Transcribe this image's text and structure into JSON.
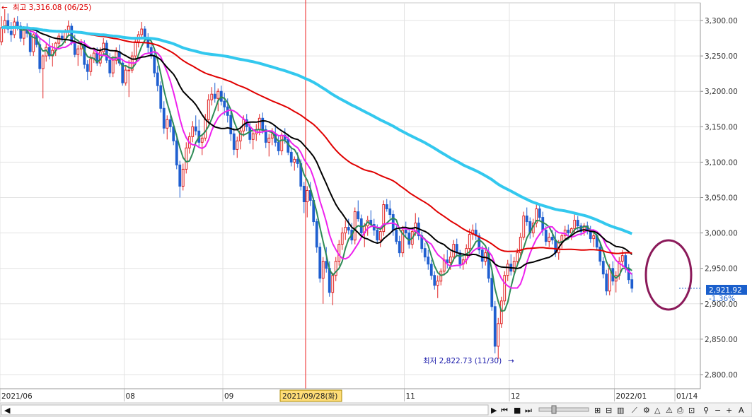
{
  "chart_data": {
    "type": "candlestick",
    "y_ticks": [
      "3,300.00",
      "3,250.00",
      "3,200.00",
      "3,150.00",
      "3,100.00",
      "3,050.00",
      "3,000.00",
      "2,950.00",
      "2,900.00",
      "2,850.00",
      "2,800.00"
    ],
    "y_range": [
      2780,
      3325
    ],
    "x_labels": [
      {
        "label": "2021/06",
        "index": 0
      },
      {
        "label": "08",
        "index": 39
      },
      {
        "label": "09",
        "index": 70
      },
      {
        "label": "11",
        "index": 127
      },
      {
        "label": "12",
        "index": 160
      },
      {
        "label": "2022/01",
        "index": 193
      },
      {
        "label": "01/14",
        "index": 212
      }
    ],
    "cursor": {
      "label": "2021/09/28(화)",
      "index": 96
    },
    "annotations": {
      "high": {
        "text": "최고 3,316.08 (06/25)",
        "value": 3316.08,
        "index": 0
      },
      "low": {
        "text": "최저 2,822.73 (11/30)",
        "value": 2822.73,
        "index": 160
      }
    },
    "last_price": {
      "value_text": "2,921.92",
      "change_text": "-1.36%",
      "value": 2921.92
    },
    "series": [
      {
        "color": "#2e8b57"
      },
      {
        "color": "#ee22ee"
      },
      {
        "color": "#000000"
      },
      {
        "color": "#e00000"
      },
      {
        "color": "#33c8ee"
      }
    ],
    "ohlc": [
      [
        3270,
        3306,
        3265,
        3290
      ],
      [
        3290,
        3316,
        3282,
        3300
      ],
      [
        3300,
        3310,
        3282,
        3288
      ],
      [
        3285,
        3298,
        3270,
        3280
      ],
      [
        3280,
        3304,
        3275,
        3298
      ],
      [
        3298,
        3306,
        3286,
        3292
      ],
      [
        3292,
        3298,
        3270,
        3275
      ],
      [
        3275,
        3292,
        3265,
        3288
      ],
      [
        3288,
        3296,
        3276,
        3282
      ],
      [
        3282,
        3290,
        3250,
        3256
      ],
      [
        3256,
        3282,
        3250,
        3280
      ],
      [
        3280,
        3290,
        3262,
        3266
      ],
      [
        3266,
        3274,
        3226,
        3232
      ],
      [
        3232,
        3252,
        3190,
        3250
      ],
      [
        3250,
        3268,
        3242,
        3262
      ],
      [
        3262,
        3275,
        3245,
        3250
      ],
      [
        3250,
        3268,
        3235,
        3258
      ],
      [
        3258,
        3270,
        3250,
        3268
      ],
      [
        3268,
        3282,
        3262,
        3278
      ],
      [
        3278,
        3286,
        3270,
        3274
      ],
      [
        3274,
        3288,
        3268,
        3284
      ],
      [
        3284,
        3300,
        3278,
        3292
      ],
      [
        3292,
        3296,
        3265,
        3270
      ],
      [
        3270,
        3280,
        3248,
        3252
      ],
      [
        3252,
        3265,
        3236,
        3260
      ],
      [
        3260,
        3274,
        3250,
        3266
      ],
      [
        3266,
        3272,
        3232,
        3238
      ],
      [
        3238,
        3244,
        3216,
        3228
      ],
      [
        3228,
        3252,
        3222,
        3246
      ],
      [
        3246,
        3262,
        3240,
        3254
      ],
      [
        3254,
        3262,
        3236,
        3240
      ],
      [
        3240,
        3262,
        3235,
        3256
      ],
      [
        3256,
        3275,
        3250,
        3268
      ],
      [
        3268,
        3272,
        3240,
        3244
      ],
      [
        3244,
        3254,
        3220,
        3226
      ],
      [
        3226,
        3250,
        3220,
        3244
      ],
      [
        3244,
        3262,
        3238,
        3256
      ],
      [
        3256,
        3266,
        3236,
        3240
      ],
      [
        3240,
        3246,
        3208,
        3212
      ],
      [
        3212,
        3236,
        3208,
        3230
      ],
      [
        3230,
        3244,
        3192,
        3230
      ],
      [
        3230,
        3256,
        3226,
        3250
      ],
      [
        3250,
        3276,
        3244,
        3270
      ],
      [
        3270,
        3285,
        3262,
        3280
      ],
      [
        3280,
        3298,
        3276,
        3288
      ],
      [
        3288,
        3292,
        3268,
        3274
      ],
      [
        3274,
        3282,
        3254,
        3262
      ],
      [
        3262,
        3270,
        3246,
        3250
      ],
      [
        3250,
        3258,
        3220,
        3226
      ],
      [
        3226,
        3236,
        3200,
        3208
      ],
      [
        3208,
        3214,
        3170,
        3176
      ],
      [
        3176,
        3186,
        3140,
        3148
      ],
      [
        3148,
        3166,
        3132,
        3160
      ],
      [
        3160,
        3172,
        3142,
        3150
      ],
      [
        3150,
        3156,
        3124,
        3130
      ],
      [
        3130,
        3140,
        3090,
        3096
      ],
      [
        3096,
        3102,
        3050,
        3066
      ],
      [
        3066,
        3098,
        3060,
        3090
      ],
      [
        3090,
        3128,
        3084,
        3120
      ],
      [
        3120,
        3142,
        3112,
        3136
      ],
      [
        3136,
        3158,
        3128,
        3150
      ],
      [
        3150,
        3166,
        3138,
        3144
      ],
      [
        3144,
        3160,
        3122,
        3128
      ],
      [
        3128,
        3140,
        3110,
        3134
      ],
      [
        3134,
        3168,
        3130,
        3160
      ],
      [
        3160,
        3196,
        3154,
        3188
      ],
      [
        3188,
        3206,
        3180,
        3196
      ],
      [
        3196,
        3212,
        3184,
        3190
      ],
      [
        3190,
        3204,
        3172,
        3200
      ],
      [
        3200,
        3208,
        3180,
        3186
      ],
      [
        3186,
        3198,
        3166,
        3178
      ],
      [
        3178,
        3190,
        3156,
        3166
      ],
      [
        3166,
        3172,
        3130,
        3140
      ],
      [
        3140,
        3148,
        3110,
        3118
      ],
      [
        3118,
        3136,
        3106,
        3130
      ],
      [
        3130,
        3150,
        3118,
        3144
      ],
      [
        3144,
        3166,
        3136,
        3160
      ],
      [
        3160,
        3168,
        3144,
        3150
      ],
      [
        3150,
        3156,
        3126,
        3132
      ],
      [
        3132,
        3144,
        3118,
        3140
      ],
      [
        3140,
        3154,
        3130,
        3146
      ],
      [
        3146,
        3168,
        3138,
        3162
      ],
      [
        3162,
        3170,
        3140,
        3146
      ],
      [
        3146,
        3152,
        3120,
        3128
      ],
      [
        3128,
        3140,
        3108,
        3134
      ],
      [
        3134,
        3148,
        3124,
        3140
      ],
      [
        3140,
        3152,
        3122,
        3128
      ],
      [
        3128,
        3138,
        3110,
        3116
      ],
      [
        3116,
        3142,
        3110,
        3138
      ],
      [
        3138,
        3148,
        3126,
        3132
      ],
      [
        3132,
        3138,
        3110,
        3114
      ],
      [
        3114,
        3122,
        3094,
        3100
      ],
      [
        3100,
        3108,
        3088,
        3104
      ],
      [
        3104,
        3114,
        3092,
        3098
      ],
      [
        3098,
        3104,
        3060,
        3066
      ],
      [
        3066,
        3072,
        3028,
        3044
      ],
      [
        3044,
        3066,
        3022,
        3060
      ],
      [
        3060,
        3072,
        3038,
        3046
      ],
      [
        3046,
        3050,
        3010,
        3016
      ],
      [
        3016,
        3020,
        2972,
        2980
      ],
      [
        2980,
        2986,
        2930,
        2936
      ],
      [
        2936,
        2966,
        2900,
        2960
      ],
      [
        2960,
        2980,
        2944,
        2950
      ],
      [
        2950,
        2960,
        2910,
        2916
      ],
      [
        2916,
        2944,
        2898,
        2940
      ],
      [
        2940,
        2966,
        2932,
        2960
      ],
      [
        2960,
        2990,
        2954,
        2984
      ],
      [
        2984,
        3008,
        2976,
        3000
      ],
      [
        3000,
        3018,
        2990,
        3008
      ],
      [
        3008,
        3020,
        2998,
        3004
      ],
      [
        3004,
        3014,
        2984,
        2990
      ],
      [
        2990,
        3036,
        2984,
        3030
      ],
      [
        3030,
        3046,
        3016,
        3020
      ],
      [
        3020,
        3026,
        2994,
        3000
      ],
      [
        3000,
        3014,
        2980,
        3010
      ],
      [
        3010,
        3024,
        2996,
        3018
      ],
      [
        3018,
        3032,
        3010,
        3012
      ],
      [
        3012,
        3020,
        2996,
        3004
      ],
      [
        3004,
        3012,
        2986,
        2990
      ],
      [
        2990,
        3008,
        2980,
        3002
      ],
      [
        3002,
        3046,
        2996,
        3040
      ],
      [
        3040,
        3048,
        3030,
        3034
      ],
      [
        3034,
        3046,
        3020,
        3026
      ],
      [
        3026,
        3032,
        2996,
        3004
      ],
      [
        3004,
        3010,
        2984,
        2988
      ],
      [
        2988,
        2996,
        2966,
        2972
      ],
      [
        2972,
        3010,
        2966,
        3004
      ],
      [
        3004,
        3016,
        2994,
        3000
      ],
      [
        3000,
        3006,
        2978,
        2984
      ],
      [
        2984,
        3008,
        2978,
        3002
      ],
      [
        3002,
        3028,
        2996,
        3014
      ],
      [
        3014,
        3022,
        2990,
        2996
      ],
      [
        2996,
        3002,
        2972,
        2978
      ],
      [
        2978,
        2986,
        2960,
        2966
      ],
      [
        2966,
        2976,
        2948,
        2956
      ],
      [
        2956,
        2962,
        2934,
        2940
      ],
      [
        2940,
        2946,
        2920,
        2926
      ],
      [
        2926,
        2940,
        2908,
        2932
      ],
      [
        2932,
        2950,
        2926,
        2946
      ],
      [
        2946,
        2970,
        2940,
        2962
      ],
      [
        2962,
        2976,
        2950,
        2958
      ],
      [
        2958,
        2974,
        2948,
        2966
      ],
      [
        2966,
        2990,
        2960,
        2984
      ],
      [
        2984,
        2992,
        2966,
        2972
      ],
      [
        2972,
        2976,
        2950,
        2956
      ],
      [
        2956,
        2966,
        2948,
        2962
      ],
      [
        2962,
        2984,
        2956,
        2978
      ],
      [
        2978,
        3006,
        2970,
        2998
      ],
      [
        2998,
        3012,
        2990,
        3004
      ],
      [
        3004,
        3014,
        2990,
        2996
      ],
      [
        2996,
        3000,
        2970,
        2976
      ],
      [
        2976,
        2982,
        2950,
        2960
      ],
      [
        2960,
        2976,
        2954,
        2972
      ],
      [
        2972,
        2980,
        2930,
        2936
      ],
      [
        2936,
        2946,
        2890,
        2896
      ],
      [
        2896,
        2904,
        2830,
        2840
      ],
      [
        2840,
        2880,
        2822,
        2872
      ],
      [
        2872,
        2910,
        2866,
        2904
      ],
      [
        2904,
        2946,
        2898,
        2940
      ],
      [
        2940,
        2962,
        2932,
        2956
      ],
      [
        2956,
        2970,
        2940,
        2946
      ],
      [
        2946,
        2966,
        2940,
        2960
      ],
      [
        2960,
        2978,
        2954,
        2972
      ],
      [
        2972,
        3000,
        2966,
        2994
      ],
      [
        2994,
        3030,
        2990,
        3024
      ],
      [
        3024,
        3036,
        3010,
        3016
      ],
      [
        3016,
        3022,
        2992,
        3000
      ],
      [
        3000,
        3020,
        2994,
        3014
      ],
      [
        3014,
        3040,
        3008,
        3034
      ],
      [
        3034,
        3042,
        3018,
        3022
      ],
      [
        3022,
        3030,
        2996,
        3004
      ],
      [
        3004,
        3010,
        2982,
        2988
      ],
      [
        2988,
        3000,
        2980,
        2994
      ],
      [
        2994,
        3004,
        2984,
        2990
      ],
      [
        2990,
        3002,
        2966,
        2972
      ],
      [
        2972,
        2990,
        2962,
        2986
      ],
      [
        2986,
        3000,
        2978,
        2996
      ],
      [
        2996,
        3010,
        2990,
        3004
      ],
      [
        3004,
        3012,
        2994,
        3000
      ],
      [
        3000,
        3008,
        2990,
        3006
      ],
      [
        3006,
        3026,
        3000,
        3018
      ],
      [
        3018,
        3024,
        3004,
        3010
      ],
      [
        3010,
        3014,
        2996,
        3002
      ],
      [
        3002,
        3014,
        2996,
        3010
      ],
      [
        3010,
        3016,
        2998,
        3004
      ],
      [
        3004,
        3010,
        2986,
        2992
      ],
      [
        2992,
        3000,
        2980,
        2996
      ],
      [
        2996,
        3000,
        2976,
        2980
      ],
      [
        2980,
        2986,
        2954,
        2960
      ],
      [
        2960,
        2966,
        2936,
        2942
      ],
      [
        2942,
        2948,
        2912,
        2918
      ],
      [
        2918,
        2956,
        2912,
        2950
      ],
      [
        2950,
        2960,
        2926,
        2932
      ],
      [
        2932,
        2946,
        2916,
        2940
      ],
      [
        2940,
        2966,
        2934,
        2960
      ],
      [
        2960,
        2976,
        2952,
        2968
      ],
      [
        2968,
        2972,
        2944,
        2950
      ],
      [
        2950,
        2956,
        2928,
        2934
      ],
      [
        2934,
        2944,
        2916,
        2921.92
      ]
    ]
  }
}
